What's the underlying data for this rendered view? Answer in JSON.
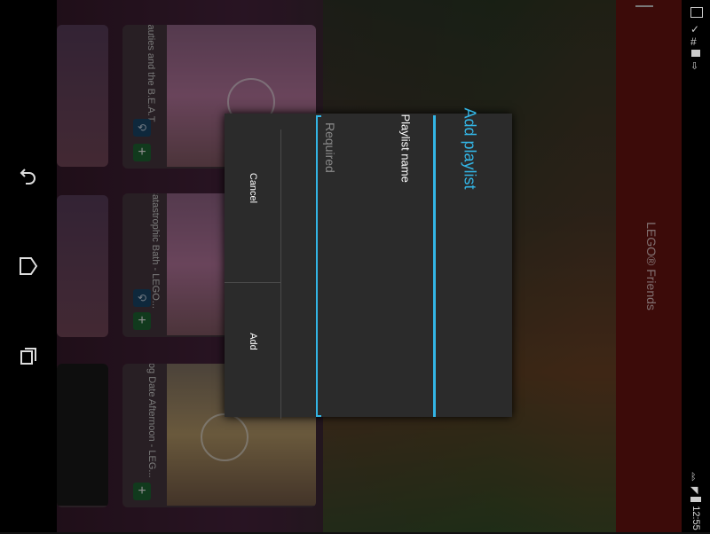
{
  "app": {
    "title": "LEGO® Friends"
  },
  "navbar": {
    "back_icon": "back-icon",
    "home_icon": "home-icon",
    "recent_icon": "recent-apps-icon"
  },
  "statusbar": {
    "time": "12:55"
  },
  "videos": [
    {
      "title": "Beauties and the B.E.A.T.",
      "buttons": [
        "download",
        "add"
      ]
    },
    {
      "title": "Catastrophic Bath - LEGO...",
      "buttons": [
        "download",
        "add"
      ]
    },
    {
      "title": "Dog Date Afternoon - LEG...",
      "buttons": [
        "add"
      ]
    }
  ],
  "dialog": {
    "title": "Add playlist",
    "field_label": "Playlist name",
    "field_placeholder": "Required",
    "cancel_label": "Cancel",
    "add_label": "Add"
  },
  "colors": {
    "accent": "#33b5e5",
    "appbar": "#6d1412",
    "add_button": "#1f6b36"
  }
}
